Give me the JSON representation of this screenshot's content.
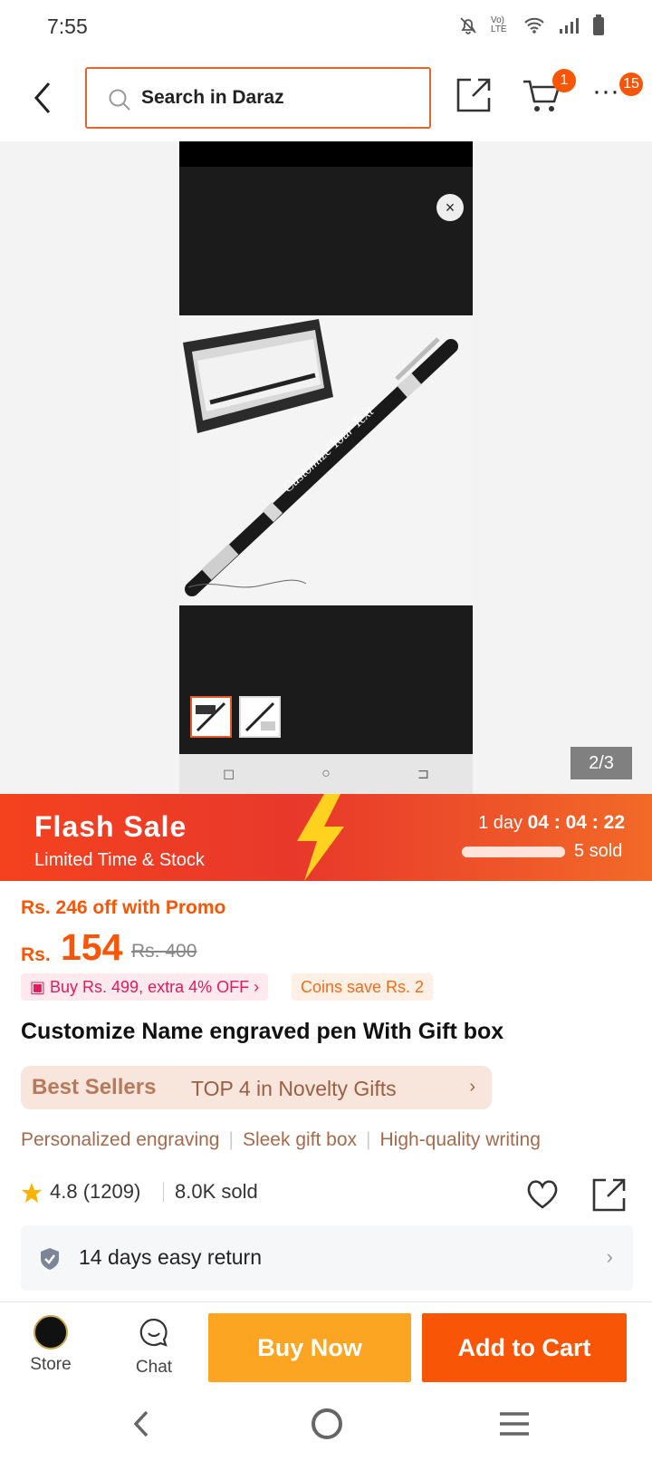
{
  "status": {
    "time": "7:55",
    "icons": [
      "mute-icon",
      "volte-icon",
      "wifi-icon",
      "signal-icon",
      "battery-icon"
    ],
    "volte_label": "Vo) LTE"
  },
  "header": {
    "search_placeholder": "Search in Daraz",
    "cart_badge": "1",
    "more_badge": "15"
  },
  "gallery": {
    "page_indicator": "2/3",
    "close_symbol": "×",
    "nav_glyphs": [
      "◻",
      "○",
      "⊐"
    ]
  },
  "flash_sale": {
    "title": "Flash Sale",
    "subtitle": "Limited Time & Stock",
    "days": "1 day",
    "time": "04 : 04 : 22",
    "sold_label": "5 sold",
    "sold_fraction": 1.0
  },
  "pricing": {
    "promo": "Rs. 246 off with Promo",
    "currency": "Rs.",
    "price": "154",
    "original_price": "Rs. 400",
    "voucher_1": "Buy Rs. 499, extra 4% OFF",
    "voucher_2": "Coins save Rs. 2"
  },
  "product": {
    "title": "Customize Name engraved pen With Gift box",
    "best_logo": "Best Sellers",
    "best_text": "TOP 4 in Novelty Gifts",
    "tags": [
      "Personalized engraving",
      "Sleek gift box",
      "High-quality writing"
    ],
    "rating": "4.8 (1209)",
    "sold": "8.0K sold"
  },
  "returns": {
    "label": "14 days easy return"
  },
  "bottom_bar": {
    "store_label": "Store",
    "chat_label": "Chat",
    "buy_now": "Buy Now",
    "add_to_cart": "Add to Cart"
  },
  "colors": {
    "accent": "#f85606",
    "buy_now": "#fba522",
    "search_border": "#e8622a"
  }
}
